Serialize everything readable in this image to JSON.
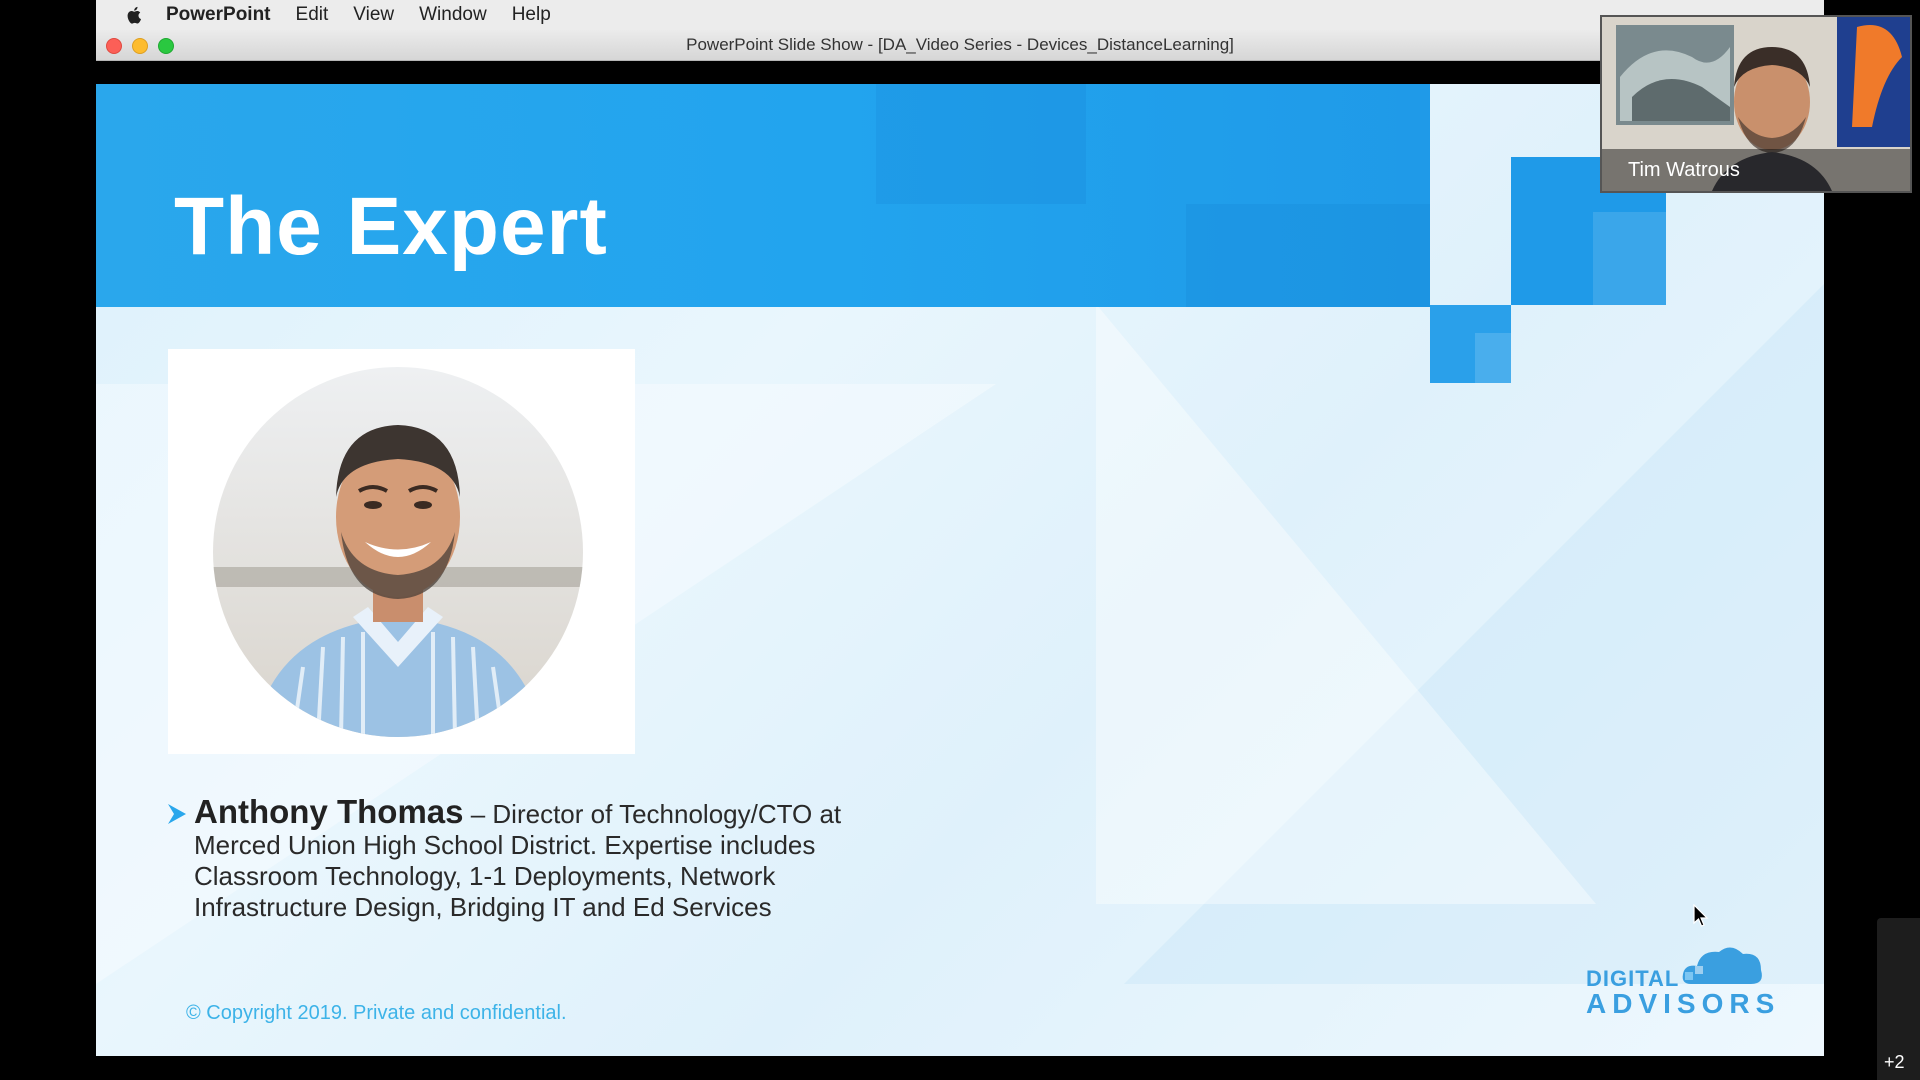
{
  "menubar": {
    "apple_icon": "apple-icon",
    "app_name": "PowerPoint",
    "items": [
      "Edit",
      "View",
      "Window",
      "Help"
    ]
  },
  "window": {
    "title": "PowerPoint Slide Show - [DA_Video Series - Devices_DistanceLearning]"
  },
  "slide": {
    "title": "The Expert",
    "person_name": "Anthony Thomas",
    "person_desc": " – Director of Technology/CTO at Merced Union High School District. Expertise includes Classroom Technology, 1-1 Deployments, Network Infrastructure Design, Bridging IT and Ed Services",
    "copyright": "© Copyright 2019. Private and confidential.",
    "logo_line1": "DIGITAL",
    "logo_line2": "ADVISORS",
    "accent_color": "#22a4ee"
  },
  "video_tile": {
    "participant_name": "Tim Watrous"
  },
  "participants_overflow": "+2"
}
